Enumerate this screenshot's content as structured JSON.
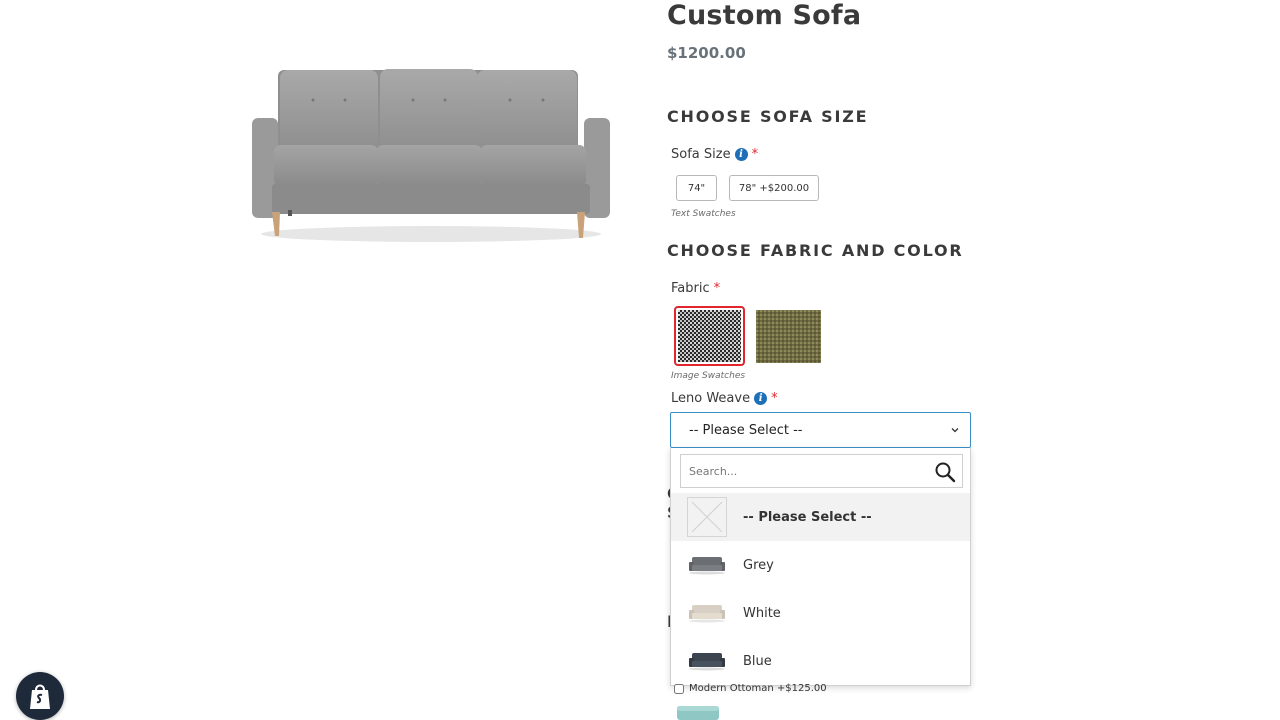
{
  "product": {
    "title": "Custom Sofa",
    "price": "$1200.00",
    "image_icon": "sofa-image"
  },
  "size_section": {
    "heading": "CHOOSE SOFA SIZE",
    "label": "Sofa Size",
    "required_mark": "*",
    "options": [
      {
        "label": "74\""
      },
      {
        "label": "78\" +$200.00"
      }
    ],
    "hint": "Text Swatches"
  },
  "fabric_section": {
    "heading": "CHOOSE FABRIC AND COLOR",
    "label": "Fabric",
    "required_mark": "*",
    "swatches": [
      {
        "name": "black-white-weave",
        "selected": true
      },
      {
        "name": "olive-weave",
        "selected": false
      }
    ],
    "hint": "Image Swatches"
  },
  "leno_weave": {
    "label": "Leno Weave",
    "required_mark": "*",
    "selected_value": "-- Please Select --",
    "search_placeholder": "Search...",
    "options": [
      {
        "label": "-- Please Select --",
        "active": true
      },
      {
        "label": "Grey",
        "color": "#6b6f73"
      },
      {
        "label": "White",
        "color": "#d8d0c4"
      },
      {
        "label": "Blue",
        "color": "#3c4550"
      }
    ]
  },
  "addons": {
    "ottoman_label": "Modern Ottoman +$125.00"
  },
  "colors": {
    "accent_red": "#e0262c",
    "info_blue": "#1f6fb8",
    "select_border": "#3a8fc7"
  }
}
